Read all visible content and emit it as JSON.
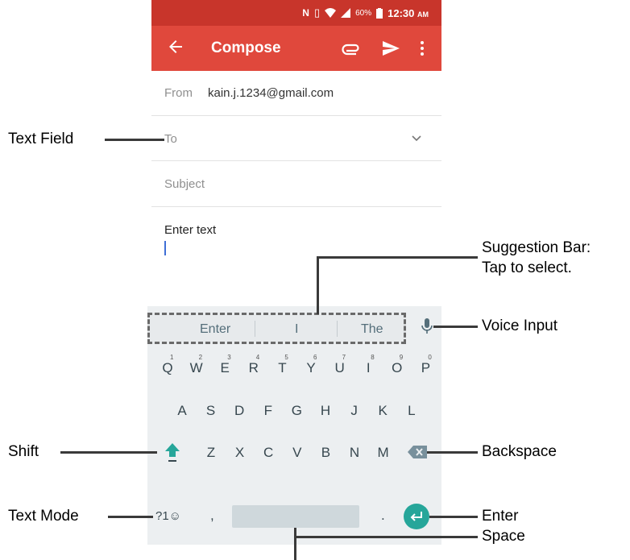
{
  "status_bar": {
    "battery": "60%",
    "time": "12:30",
    "ampm": "AM"
  },
  "app_bar": {
    "title": "Compose"
  },
  "form": {
    "from_label": "From",
    "from_value": "kain.j.1234@gmail.com",
    "to_label": "To",
    "subject_label": "Subject",
    "body_text": "Enter text"
  },
  "suggestions": [
    "Enter",
    "I",
    "The"
  ],
  "keyboard": {
    "row1": [
      "Q",
      "W",
      "E",
      "R",
      "T",
      "Y",
      "U",
      "I",
      "O",
      "P"
    ],
    "row1_digits": [
      "1",
      "2",
      "3",
      "4",
      "5",
      "6",
      "7",
      "8",
      "9",
      "0"
    ],
    "row2": [
      "A",
      "S",
      "D",
      "F",
      "G",
      "H",
      "J",
      "K",
      "L"
    ],
    "row3": [
      "Z",
      "X",
      "C",
      "V",
      "B",
      "N",
      "M"
    ],
    "mode_label": "?1☺",
    "comma": ",",
    "period": "."
  },
  "callouts": {
    "text_field": "Text Field",
    "suggestion_bar_1": "Suggestion Bar:",
    "suggestion_bar_2": "Tap to select.",
    "voice_input": "Voice Input",
    "shift": "Shift",
    "backspace": "Backspace",
    "text_mode": "Text Mode",
    "enter": "Enter",
    "space": "Space"
  },
  "icons": [
    "arrow-back-icon",
    "paperclip-icon",
    "send-icon",
    "more-vert-icon",
    "chevron-down-icon",
    "mic-icon",
    "shift-arrow-icon",
    "backspace-icon",
    "enter-icon",
    "nfc-icon",
    "vibrate-icon",
    "wifi-icon",
    "signal-icon",
    "battery-icon"
  ],
  "colors": {
    "status_bar": "#c8352b",
    "app_bar": "#e0483c",
    "accent": "#26a69a",
    "keyboard_bg": "#eceff1"
  }
}
